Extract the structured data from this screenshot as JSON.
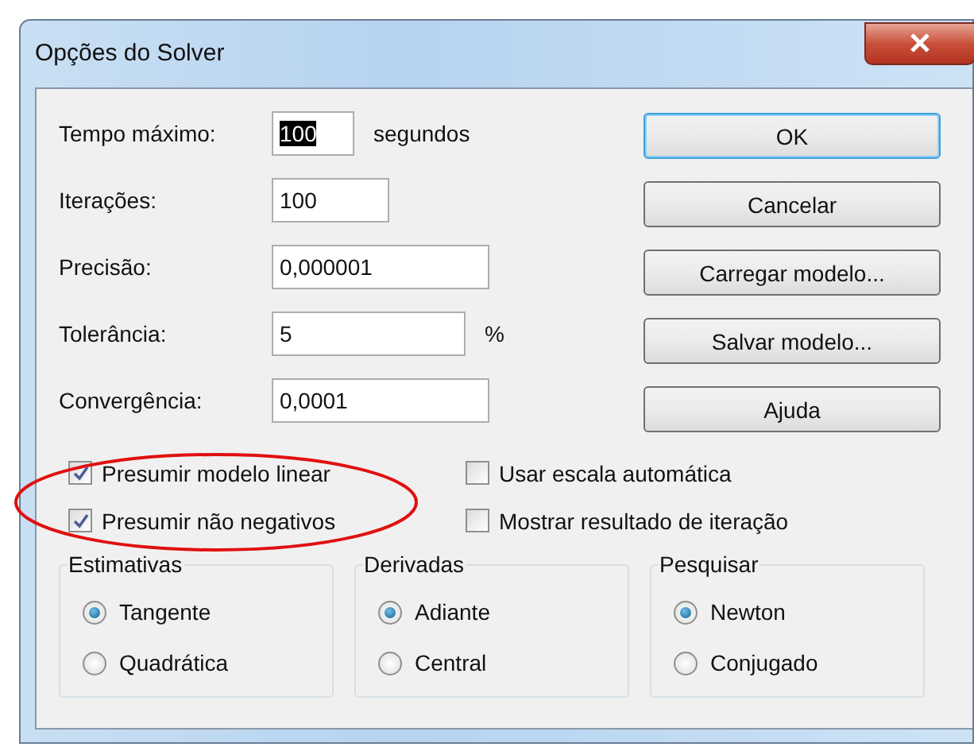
{
  "window": {
    "title": "Opções do Solver"
  },
  "fields": [
    {
      "label": "Tempo máximo:",
      "value": "100",
      "unit": "segundos",
      "text_selected": true
    },
    {
      "label": "Iterações:",
      "value": "100",
      "text_selected": false
    },
    {
      "label": "Precisão:",
      "value": "0,000001",
      "text_selected": false
    },
    {
      "label": "Tolerância:",
      "value": "5",
      "unit": "%",
      "text_selected": false
    },
    {
      "label": "Convergência:",
      "value": "0,0001",
      "text_selected": false
    }
  ],
  "buttons": [
    {
      "label": "OK",
      "default": true
    },
    {
      "label": "Cancelar",
      "default": false
    },
    {
      "label": "Carregar modelo...",
      "default": false
    },
    {
      "label": "Salvar modelo...",
      "default": false
    },
    {
      "label": "Ajuda",
      "default": false
    }
  ],
  "checkboxes": [
    {
      "label": "Presumir modelo linear",
      "checked": true
    },
    {
      "label": "Usar escala automática",
      "checked": false
    },
    {
      "label": "Presumir não negativos",
      "checked": true
    },
    {
      "label": "Mostrar resultado de iteração",
      "checked": false
    }
  ],
  "groups": [
    {
      "title": "Estimativas",
      "options": [
        {
          "label": "Tangente",
          "selected": true
        },
        {
          "label": "Quadrática",
          "selected": false
        }
      ]
    },
    {
      "title": "Derivadas",
      "options": [
        {
          "label": "Adiante",
          "selected": true
        },
        {
          "label": "Central",
          "selected": false
        }
      ]
    },
    {
      "title": "Pesquisar",
      "options": [
        {
          "label": "Newton",
          "selected": true
        },
        {
          "label": "Conjugado",
          "selected": false
        }
      ]
    }
  ]
}
